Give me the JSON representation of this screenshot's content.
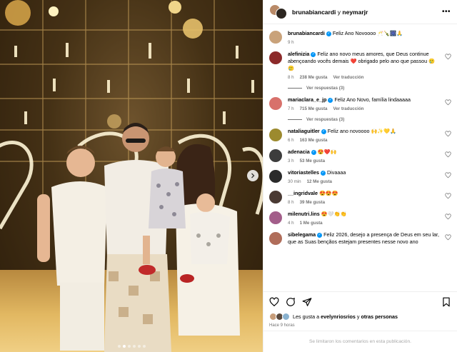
{
  "post": {
    "author_primary": "brunabiancardi",
    "header_joiner": "y",
    "author_secondary": "neymarjr",
    "more_icon": "more-horizontal-icon"
  },
  "photo": {
    "carousel_dots_total": 6,
    "carousel_active_index": 1
  },
  "comments": [
    {
      "username": "brunabiancardi",
      "verified": true,
      "text": "Feliz Ano Novoooo 🥂🍾🎆🙏",
      "time": "9 h",
      "likes": "",
      "translate": "",
      "replies": "",
      "avatar_color": "#c9a27a",
      "show_heart": false
    },
    {
      "username": "alefinizia",
      "verified": true,
      "text": "Feliz ano novo meus amores, que Deus continue abençoando vocês demais ❤️ obrigado pelo ano que passou 🥲🥲",
      "time": "8 h",
      "likes": "238 Me gusta",
      "translate": "Ver traducción",
      "replies": "Ver respuestas (3)",
      "avatar_color": "#8c2a2a",
      "show_heart": true
    },
    {
      "username": "mariaclara_e_jp",
      "verified": true,
      "text": "Feliz Ano Novo, família lindaaaaa",
      "time": "7 h",
      "likes": "715 Me gusta",
      "translate": "Ver traducción",
      "replies": "Ver respuestas (3)",
      "avatar_color": "#d8716b",
      "show_heart": true
    },
    {
      "username": "nataliaguitler",
      "verified": true,
      "text": "Feliz ano novoooo 🙌✨💛🙏",
      "time": "6 h",
      "likes": "163 Me gusta",
      "translate": "",
      "replies": "",
      "avatar_color": "#9c8a2e",
      "show_heart": true
    },
    {
      "username": "adenacia",
      "verified": true,
      "text": "😍❤️🙌",
      "time": "3 h",
      "likes": "53 Me gusta",
      "translate": "",
      "replies": "",
      "avatar_color": "#3c3c3c",
      "show_heart": true
    },
    {
      "username": "vitoriastelles",
      "verified": true,
      "text": "Divaaaa",
      "time": "30 min",
      "likes": "12 Me gusta",
      "translate": "",
      "replies": "",
      "avatar_color": "#2a2a2a",
      "show_heart": true
    },
    {
      "username": "__ingridvale",
      "verified": false,
      "text": "😍😍😍",
      "time": "8 h",
      "likes": "39 Me gusta",
      "translate": "",
      "replies": "",
      "avatar_color": "#4a3a33",
      "show_heart": true
    },
    {
      "username": "milenutri.lins",
      "verified": false,
      "text": "😍🤍👏👏",
      "time": "4 h",
      "likes": "1 Me gusta",
      "translate": "",
      "replies": "",
      "avatar_color": "#a35e8a",
      "show_heart": true
    },
    {
      "username": "sibelegama",
      "verified": true,
      "text": "Feliz 2026, desejo a presença de Deus em seu lar, que as Suas bençãos estejam presentes nesse novo ano",
      "time": "",
      "likes": "",
      "translate": "",
      "replies": "",
      "avatar_color": "#b06d5a",
      "show_heart": true
    }
  ],
  "actions": {
    "like_icon": "heart-icon",
    "comment_icon": "comment-icon",
    "share_icon": "share-icon",
    "save_icon": "bookmark-icon",
    "likes_prefix": "Les gusta a",
    "likes_user": "evelynriosrios",
    "likes_conj": "y",
    "likes_others": "otras personas",
    "time_ago": "Hace 9 horas",
    "comments_limited": "Se limitaron los comentarios en esta publicación."
  }
}
